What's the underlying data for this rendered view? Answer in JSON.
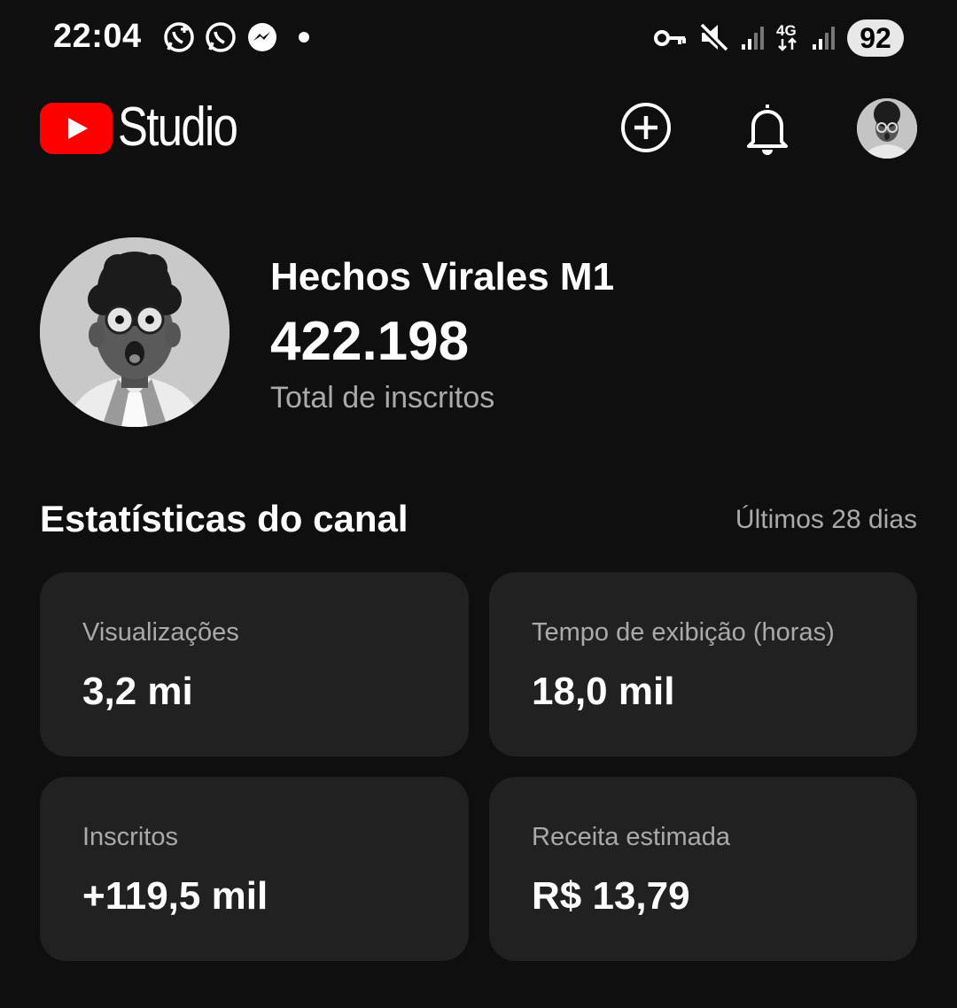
{
  "status_bar": {
    "time": "22:04",
    "left_icons": [
      "whatsapp-business-icon",
      "whatsapp-icon",
      "messenger-icon",
      "dot-indicator"
    ],
    "right_icons": [
      "vpn-key-icon",
      "mute-icon",
      "signal-icon",
      "4g-icon",
      "signal-icon"
    ],
    "battery": "92"
  },
  "header": {
    "app_name": "Studio",
    "brand_color": "#ff0000",
    "actions": [
      "create-icon",
      "notifications-icon",
      "account-avatar"
    ]
  },
  "channel": {
    "name": "Hechos Virales M1",
    "subscribers": "422.198",
    "subscribers_label": "Total de inscritos"
  },
  "stats": {
    "title": "Estatísticas do canal",
    "period": "Últimos 28 dias",
    "cards": [
      {
        "label": "Visualizações",
        "value": "3,2 mi"
      },
      {
        "label": "Tempo de exibição (horas)",
        "value": "18,0 mil"
      },
      {
        "label": "Inscritos",
        "value": "+119,5 mil"
      },
      {
        "label": "Receita estimada",
        "value": "R$ 13,79"
      }
    ]
  }
}
